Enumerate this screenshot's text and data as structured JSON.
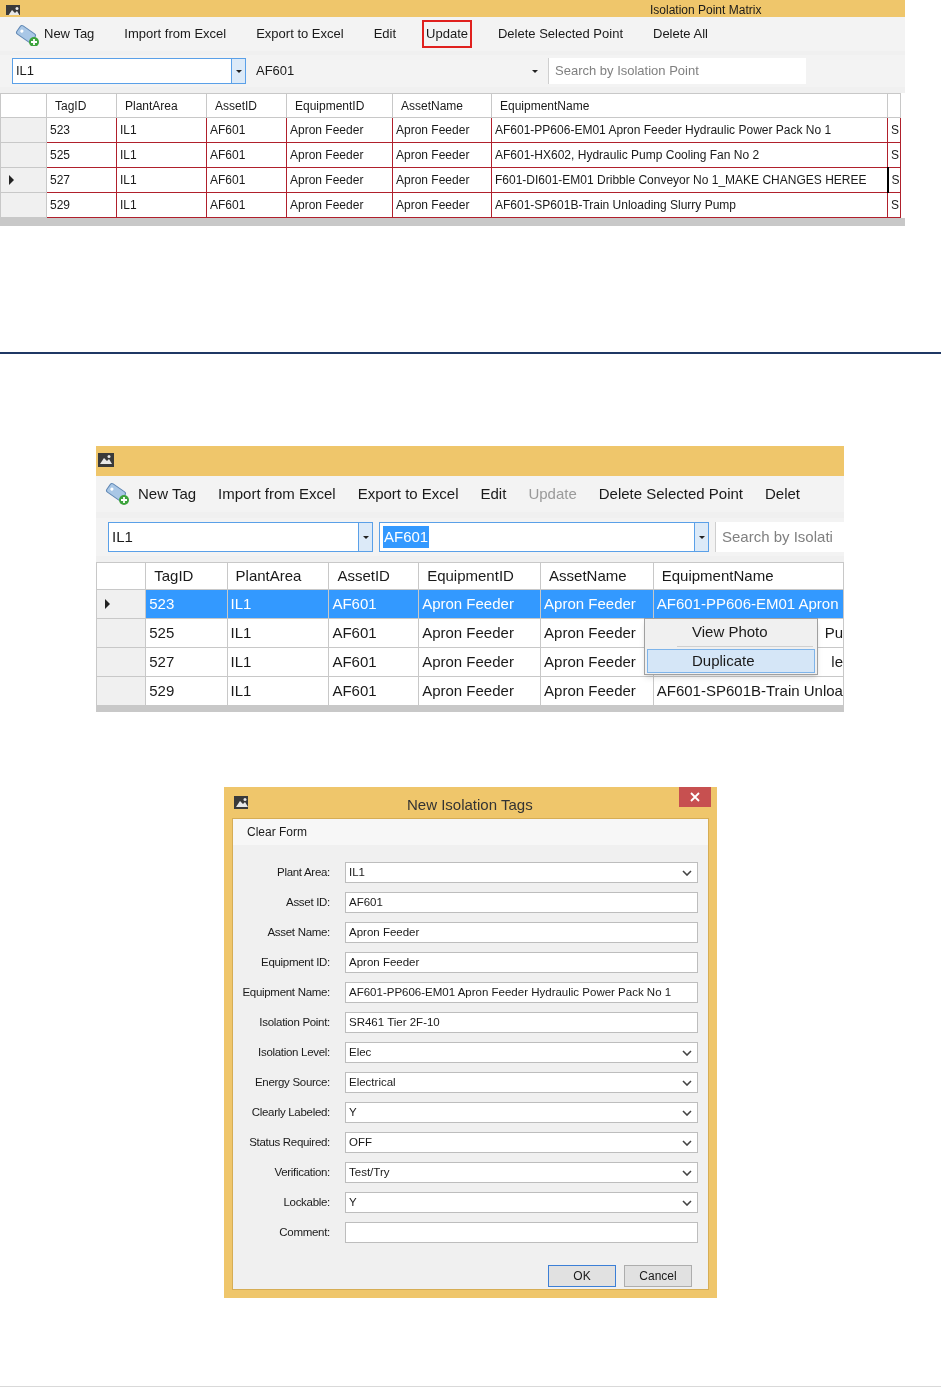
{
  "matrix_window": {
    "title": "Isolation Point Matrix",
    "toolbar": [
      {
        "label": "New Tag",
        "kind": "icon",
        "highlighted": false,
        "disabled": false
      },
      {
        "label": "Import from Excel",
        "kind": "text",
        "highlighted": false,
        "disabled": false
      },
      {
        "label": "Export to Excel",
        "kind": "text",
        "highlighted": false,
        "disabled": false
      },
      {
        "label": "Edit",
        "kind": "text",
        "highlighted": false,
        "disabled": false
      },
      {
        "label": "Update",
        "kind": "text",
        "highlighted": true,
        "disabled": false
      },
      {
        "label": "Delete Selected Point",
        "kind": "text",
        "highlighted": false,
        "disabled": false
      },
      {
        "label": "Delete All",
        "kind": "text",
        "highlighted": false,
        "disabled": false
      }
    ],
    "filters": {
      "plant_area": "IL1",
      "asset": "AF601",
      "asset_text_selected": false,
      "search_placeholder": "Search by Isolation Point"
    },
    "table": {
      "columns": [
        "TagID",
        "PlantArea",
        "AssetID",
        "EquipmentID",
        "AssetName",
        "EquipmentName"
      ],
      "rows": [
        {
          "cells": [
            "523",
            "IL1",
            "AF601",
            "Apron Feeder",
            "Apron Feeder",
            "AF601-PP606-EM01 Apron Feeder Hydraulic Power Pack No 1",
            "S"
          ],
          "current": false,
          "selected": false,
          "editing": false
        },
        {
          "cells": [
            "525",
            "IL1",
            "AF601",
            "Apron Feeder",
            "Apron Feeder",
            "AF601-HX602, Hydraulic Pump Cooling Fan No 2",
            "S"
          ],
          "current": false,
          "selected": false,
          "editing": false
        },
        {
          "cells": [
            "527",
            "IL1",
            "AF601",
            "Apron Feeder",
            "Apron Feeder",
            "F601-DI601-EM01 Dribble Conveyor No 1_MAKE CHANGES HEREE",
            "S"
          ],
          "current": true,
          "selected": false,
          "editing": true
        },
        {
          "cells": [
            "529",
            "IL1",
            "AF601",
            "Apron Feeder",
            "Apron Feeder",
            "AF601-SP601B-Train Unloading Slurry Pump",
            "S"
          ],
          "current": false,
          "selected": false,
          "editing": false
        }
      ]
    }
  },
  "context_window": {
    "toolbar": [
      {
        "label": "New Tag",
        "kind": "icon",
        "highlighted": false,
        "disabled": false
      },
      {
        "label": "Import from Excel",
        "kind": "text",
        "highlighted": false,
        "disabled": false
      },
      {
        "label": "Export to Excel",
        "kind": "text",
        "highlighted": false,
        "disabled": false
      },
      {
        "label": "Edit",
        "kind": "text",
        "highlighted": false,
        "disabled": false
      },
      {
        "label": "Update",
        "kind": "text",
        "highlighted": false,
        "disabled": true
      },
      {
        "label": "Delete Selected Point",
        "kind": "text",
        "highlighted": false,
        "disabled": false
      },
      {
        "label": "Delet",
        "kind": "text",
        "highlighted": false,
        "disabled": false
      }
    ],
    "filters": {
      "plant_area": "IL1",
      "asset": "AF601",
      "asset_text_selected": true,
      "search_placeholder": "Search by Isolati"
    },
    "table": {
      "columns": [
        "TagID",
        "PlantArea",
        "AssetID",
        "EquipmentID",
        "AssetName",
        "EquipmentName"
      ],
      "rows": [
        {
          "cells": [
            "523",
            "IL1",
            "AF601",
            "Apron Feeder",
            "Apron Feeder",
            "AF601-PP606-EM01 Apron"
          ],
          "current": true,
          "selected": true,
          "editing": false
        },
        {
          "cells": [
            "525",
            "IL1",
            "AF601",
            "Apron Feeder",
            "Apron Feeder",
            "Pu"
          ],
          "current": false,
          "selected": false,
          "editing": false
        },
        {
          "cells": [
            "527",
            "IL1",
            "AF601",
            "Apron Feeder",
            "Apron Feeder",
            "le"
          ],
          "current": false,
          "selected": false,
          "editing": false
        },
        {
          "cells": [
            "529",
            "IL1",
            "AF601",
            "Apron Feeder",
            "Apron Feeder",
            "AF601-SP601B-Train Unloa"
          ],
          "current": false,
          "selected": false,
          "editing": false
        }
      ]
    },
    "context_menu": {
      "items": [
        {
          "label": "View Photo",
          "selected": false
        },
        {
          "label": "Duplicate",
          "selected": true
        }
      ]
    }
  },
  "dialog": {
    "title": "New Isolation Tags",
    "menu": [
      "Clear Form"
    ],
    "fields": [
      {
        "label": "Plant Area:",
        "value": "IL1",
        "kind": "dropdown"
      },
      {
        "label": "Asset ID:",
        "value": "AF601",
        "kind": "text"
      },
      {
        "label": "Asset Name:",
        "value": "Apron Feeder",
        "kind": "text"
      },
      {
        "label": "Equipment ID:",
        "value": "Apron Feeder",
        "kind": "text"
      },
      {
        "label": "Equipment Name:",
        "value": "AF601-PP606-EM01 Apron Feeder Hydraulic Power Pack No 1",
        "kind": "text"
      },
      {
        "label": "Isolation Point:",
        "value": "SR461 Tier 2F-10",
        "kind": "text"
      },
      {
        "label": "Isolation Level:",
        "value": "Elec",
        "kind": "dropdown"
      },
      {
        "label": "Energy Source:",
        "value": "Electrical",
        "kind": "dropdown"
      },
      {
        "label": "Clearly Labeled:",
        "value": "Y",
        "kind": "dropdown"
      },
      {
        "label": "Status Required:",
        "value": "OFF",
        "kind": "dropdown"
      },
      {
        "label": "Verification:",
        "value": "Test/Try",
        "kind": "dropdown"
      },
      {
        "label": "Lockable:",
        "value": "Y",
        "kind": "dropdown"
      },
      {
        "label": "Comment:",
        "kind": "text"
      }
    ],
    "buttons": [
      {
        "label": "OK",
        "default": true
      },
      {
        "label": "Cancel",
        "default": false
      }
    ]
  }
}
